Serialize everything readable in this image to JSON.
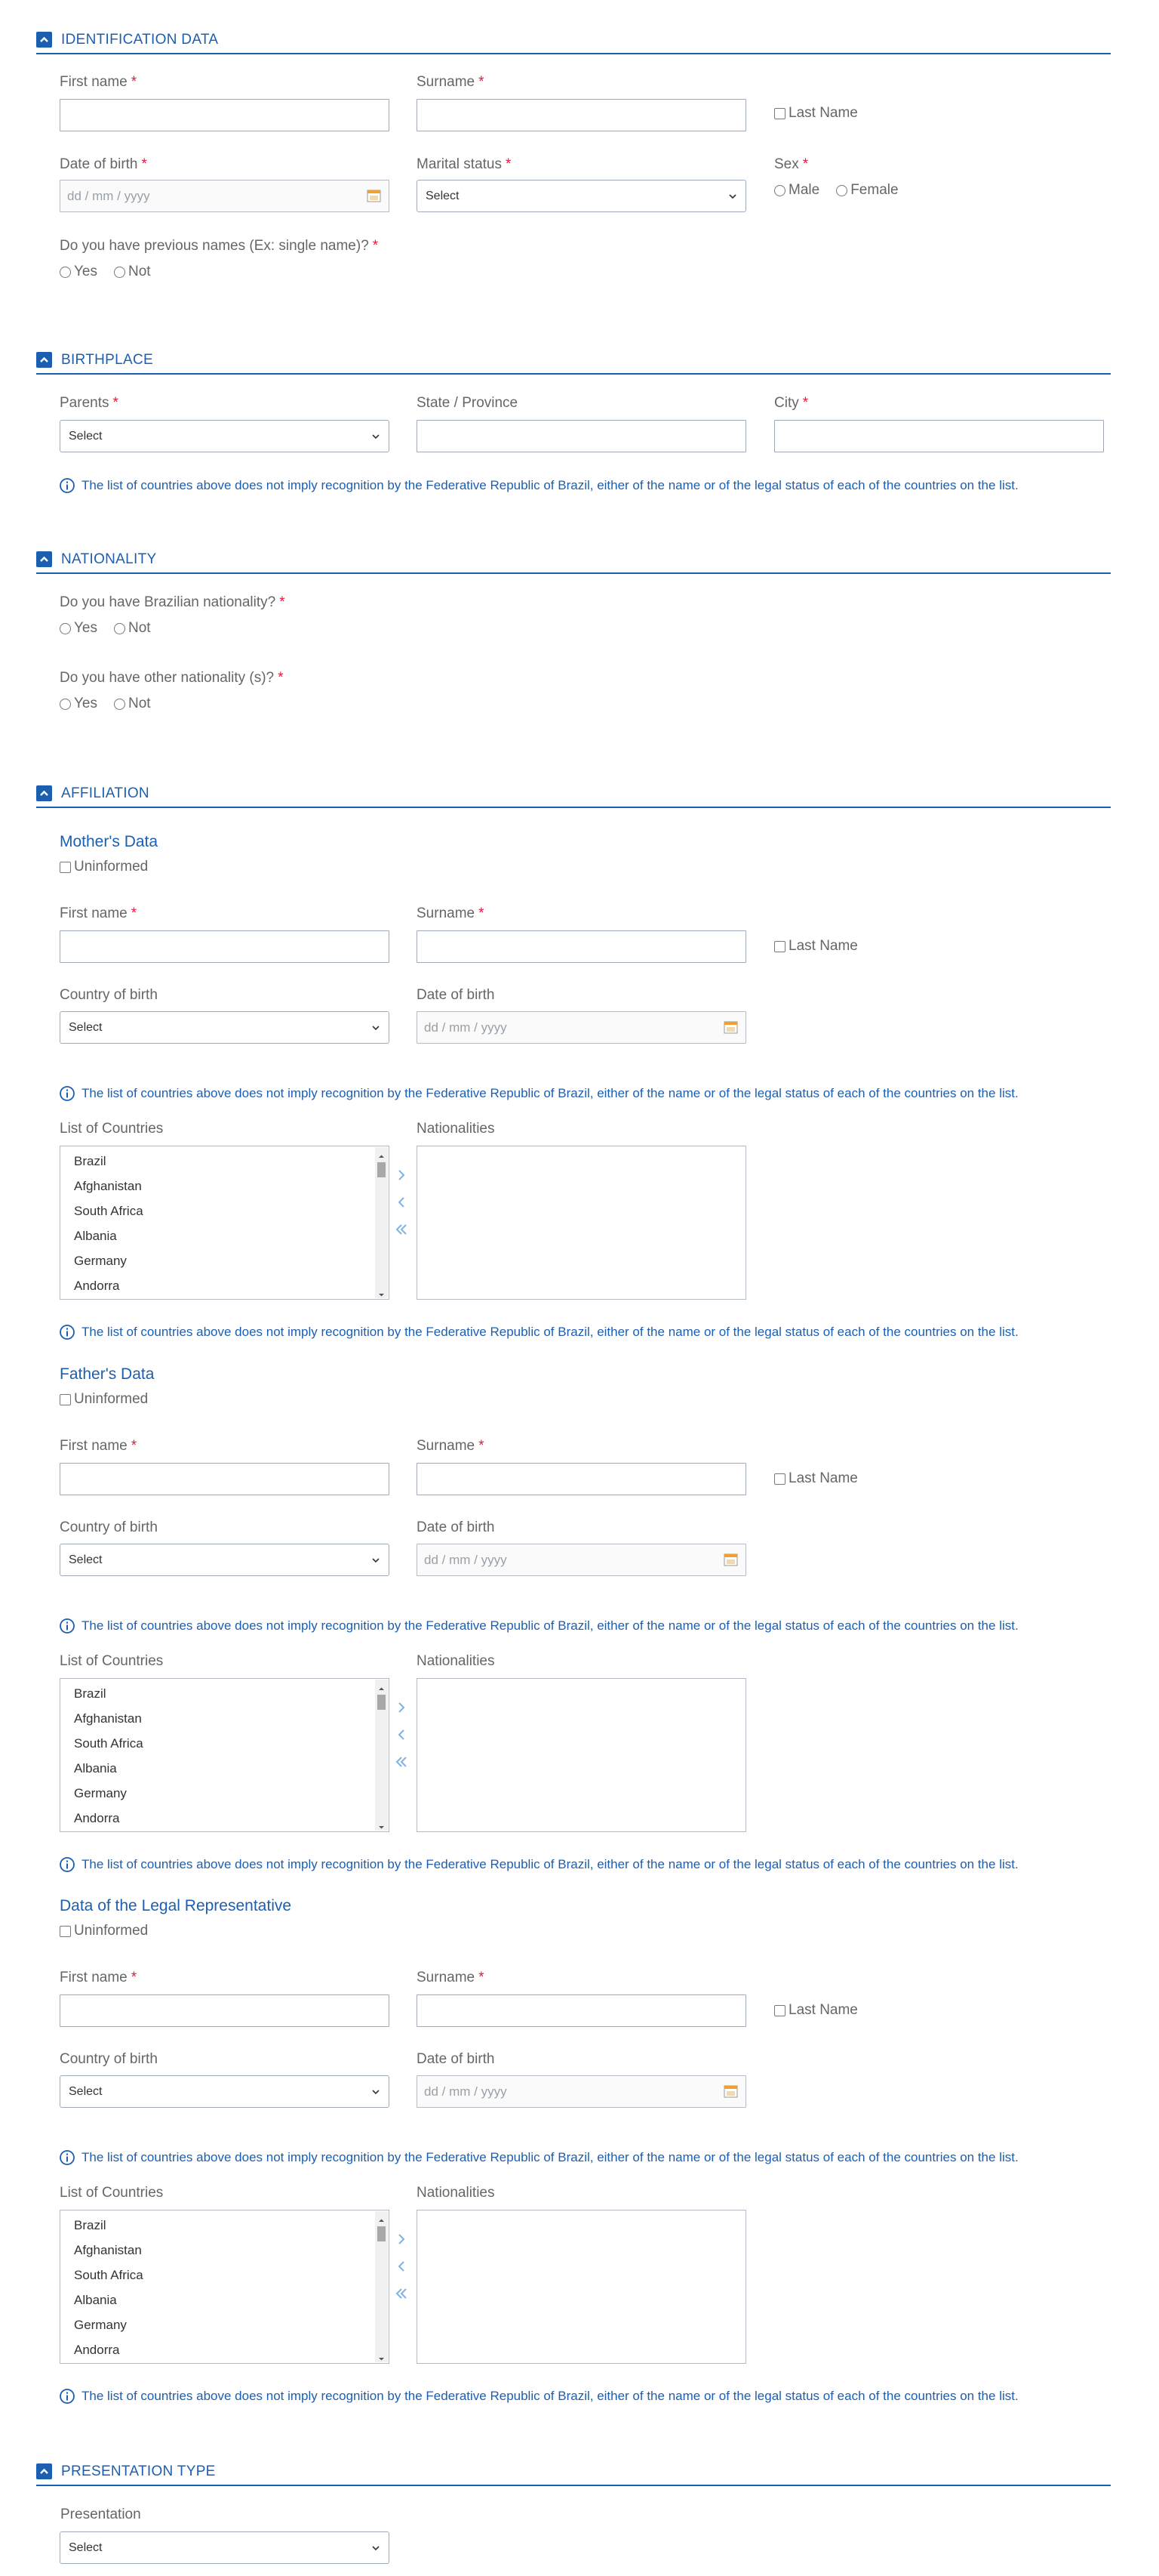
{
  "colors": {
    "accent": "#1c5fb1",
    "required": "#e5193e",
    "text": "#666666",
    "calendar": "#f0a030"
  },
  "icons": {
    "collapse": "chevron-up-icon",
    "info": "info-circle-icon",
    "calendar": "calendar-icon",
    "select": "chevron-down-icon",
    "move_right": "chevron-right-icon",
    "move_left": "chevron-left-icon",
    "move_all_left": "double-chevron-left-icon"
  },
  "common": {
    "required_mark": "*",
    "date_placeholder": "dd / mm / yyyy",
    "select_placeholder": "Select",
    "yes": "Yes",
    "no": "Not",
    "disclaimer": "The list of countries above does not imply recognition by the Federative Republic of Brazil, either of the name or of the legal status of each of the countries on the list.",
    "uninformed": "Uninformed",
    "first_name": "First name",
    "surname": "Surname",
    "last_name": "Last Name",
    "country_of_birth": "Country of birth",
    "date_of_birth": "Date of birth",
    "list_of_countries": "List of Countries",
    "nationalities": "Nationalities",
    "countries": [
      "Brazil",
      "Afghanistan",
      "South Africa",
      "Albania",
      "Germany",
      "Andorra"
    ]
  },
  "identification": {
    "title": "IDENTIFICATION DATA",
    "first_name": "First name",
    "surname": "Surname",
    "last_name": "Last Name",
    "date_of_birth": "Date of birth",
    "marital_status": "Marital status",
    "sex": "Sex",
    "male": "Male",
    "female": "Female",
    "previous_names": "Do you have previous names (Ex: single name)?"
  },
  "birthplace": {
    "title": "BIRTHPLACE",
    "parents": "Parents",
    "state": "State / Province",
    "city": "City"
  },
  "nationality": {
    "title": "NATIONALITY",
    "brazilian": "Do you have Brazilian nationality?",
    "other": "Do you have other nationality (s)?"
  },
  "affiliation": {
    "title": "AFFILIATION",
    "mother": "Mother's Data",
    "father": "Father's Data",
    "legal": "Data of the Legal Representative"
  },
  "presentation": {
    "title": "PRESENTATION TYPE",
    "label": "Presentation"
  }
}
